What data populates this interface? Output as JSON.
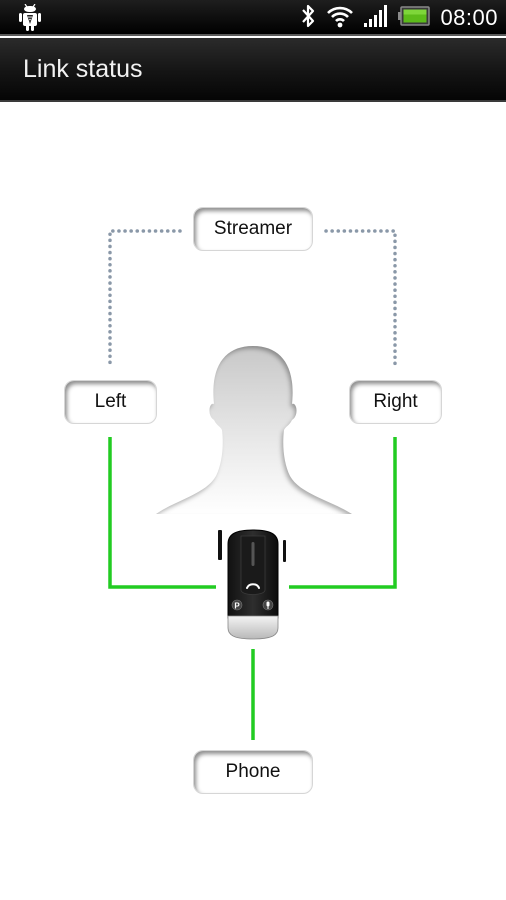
{
  "status_bar": {
    "left_icons": [
      "android-debug-icon"
    ],
    "right_icons": [
      "bluetooth-icon",
      "wifi-icon",
      "signal-icon",
      "battery-icon"
    ],
    "time": "08:00",
    "battery_color": "#4caf12"
  },
  "title_bar": {
    "title": "Link status"
  },
  "diagram": {
    "nodes": {
      "streamer": "Streamer",
      "left": "Left",
      "right": "Right",
      "phone": "Phone"
    },
    "links": [
      {
        "from": "streamer",
        "to": "left",
        "state": "inactive",
        "style": "dotted"
      },
      {
        "from": "streamer",
        "to": "right",
        "state": "inactive",
        "style": "dotted"
      },
      {
        "from": "device",
        "to": "left",
        "state": "active",
        "style": "solid"
      },
      {
        "from": "device",
        "to": "right",
        "state": "active",
        "style": "solid"
      },
      {
        "from": "device",
        "to": "phone",
        "state": "active",
        "style": "solid"
      }
    ],
    "colors": {
      "active_link": "#22cc22",
      "inactive_link": "#8a98a8"
    },
    "center_image": "person-silhouette",
    "device_image": "streamer-device",
    "device_buttons": [
      "call-icon",
      "p-button-icon",
      "mic-icon"
    ]
  }
}
